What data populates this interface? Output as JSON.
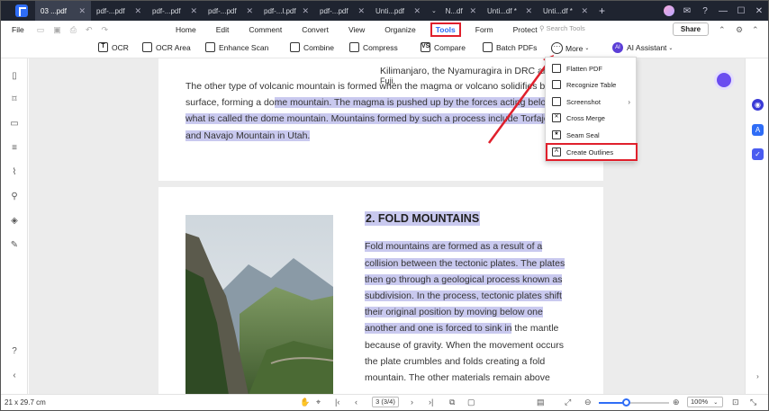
{
  "tabs": [
    {
      "label": "03 ...pdf",
      "active": true
    },
    {
      "label": "pdf-...pdf"
    },
    {
      "label": "pdf-...pdf"
    },
    {
      "label": "pdf-...pdf"
    },
    {
      "label": "pdf-...l.pdf"
    },
    {
      "label": "pdf-...pdf"
    },
    {
      "label": "Unti...pdf"
    },
    {
      "label": "N...df"
    },
    {
      "label": "Unti...df *"
    },
    {
      "label": "Unti...df *"
    }
  ],
  "tab_add": "+",
  "window_controls": {
    "minimize": "—",
    "restore": "☐",
    "close": "✕",
    "bell": "✉",
    "help": "?"
  },
  "menubar": {
    "file": "File",
    "items": [
      "Home",
      "Edit",
      "Comment",
      "Convert",
      "View",
      "Organize"
    ],
    "tools": "Tools",
    "items_after": [
      "Form",
      "Protect"
    ],
    "search_placeholder": "Search Tools",
    "share": "Share"
  },
  "toolbar": {
    "ocr": "OCR",
    "ocr_area": "OCR Area",
    "enhance_scan": "Enhance Scan",
    "combine": "Combine",
    "compress": "Compress",
    "compare": "Compare",
    "batch_pdfs": "Batch PDFs",
    "more": "More",
    "ai_assistant": "AI Assistant"
  },
  "more_menu": {
    "items": [
      {
        "label": "Flatten PDF",
        "icon": "flatten-icon"
      },
      {
        "label": "Recognize Table",
        "icon": "table-icon"
      },
      {
        "label": "Screenshot",
        "icon": "screenshot-icon",
        "submenu": "›"
      },
      {
        "label": "Cross Merge",
        "icon": "cross-merge-icon"
      },
      {
        "label": "Seam Seal",
        "icon": "seal-icon"
      },
      {
        "label": "Create Outlines",
        "icon": "outline-icon",
        "highlighted": true
      }
    ]
  },
  "document": {
    "page1": {
      "line0": "Kilimanjaro, the Nyamuragira in DRC and",
      "line0b": "Fuji.",
      "line1": "The other type of volcanic mountain is formed when the magma or volcano solidifies beneath the",
      "line2a": "surface, forming a do",
      "line2b": "me mountain. The magma is pushed up by the forces acting below it resulting in",
      "line3": "what is called the dome mountain. Mountains formed by such a process include Torfajokull in Iceland",
      "line4": "and Navajo Mountain in Utah."
    },
    "page2": {
      "heading": "2. FOLD MOUNTAINS",
      "lines": [
        "Fold mountains are formed as a result of a",
        "collision between the tectonic plates. The plates",
        "then go through a geological process known as",
        "subdivision. In the process, tectonic plates shift",
        "their original position by moving below one",
        "another and one is forced to sink in"
      ],
      "line_tail": " the mantle",
      "rest": [
        "because of gravity. When the movement occurs",
        "the plate crumbles and folds creating a fold",
        "mountain. The other materials remain above"
      ]
    }
  },
  "status": {
    "dimensions": "21 x 29.7 cm",
    "page": "3 (3/4)",
    "zoom": "100%",
    "zoom_level": 0.38
  },
  "colors": {
    "accent": "#2f6df6",
    "highlight": "#c9c9ef",
    "callout": "#e0202c"
  }
}
